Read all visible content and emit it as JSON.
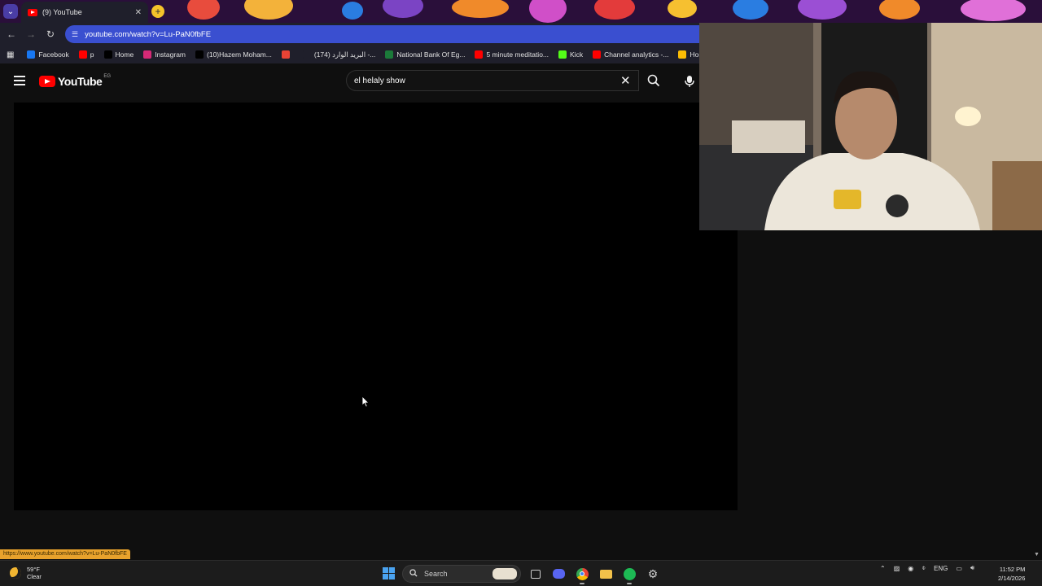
{
  "browser": {
    "tab_title": "(9) YouTube",
    "url": "youtube.com/watch?v=Lu-PaN0fbFE",
    "status_url": "https://www.youtube.com/watch?v=Lu-PaN0fbFE",
    "bookmarks": [
      {
        "label": "Facebook",
        "icon": "facebook-icon",
        "color": "#1877f2"
      },
      {
        "label": "p",
        "icon": "youtube-icon",
        "color": "#ff0000"
      },
      {
        "label": "Home",
        "icon": "x-icon",
        "color": "#000000"
      },
      {
        "label": "Instagram",
        "icon": "instagram-icon",
        "color": "#d62976"
      },
      {
        "label": "(10)Hazem Moham...",
        "icon": "tiktok-icon",
        "color": "#000000"
      },
      {
        "label": "",
        "icon": "gmail-icon",
        "color": "#ea4335"
      },
      {
        "label": "(174) البريد الوارد -...",
        "icon": "mail-icon",
        "color": "#1f1f2b"
      },
      {
        "label": "National Bank Of Eg...",
        "icon": "bank-icon",
        "color": "#1b7a3a"
      },
      {
        "label": "5 minute meditatio...",
        "icon": "youtube-icon",
        "color": "#ff0000"
      },
      {
        "label": "Kick",
        "icon": "kick-icon",
        "color": "#53fc18"
      },
      {
        "label": "Channel analytics -...",
        "icon": "youtube-studio-icon",
        "color": "#ff0000"
      },
      {
        "label": "Home - Google",
        "icon": "google-drive-icon",
        "color": "#fbbc04"
      }
    ]
  },
  "youtube": {
    "logo_text": "YouTube",
    "country_code": "EG",
    "search_query": "el helaly show"
  },
  "taskbar": {
    "weather_temp": "59°F",
    "weather_desc": "Clear",
    "search_placeholder": "Search",
    "language": "ENG",
    "time": "11:52 PM",
    "date": "2/14/2026"
  },
  "colors": {
    "youtube_red": "#ff0000",
    "omnibox_accent": "#3a4fd0",
    "status_url_bg": "#e8a22c"
  }
}
